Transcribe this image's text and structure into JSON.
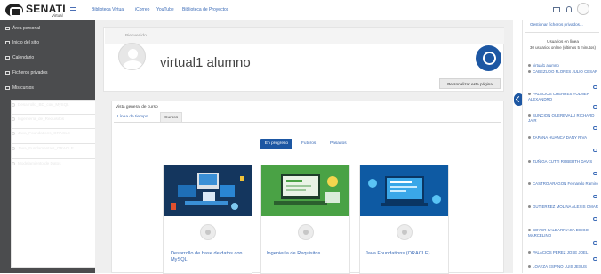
{
  "brand": {
    "name": "SENATI",
    "sub": "Virtual"
  },
  "top_links": [
    "Biblioteca Virtual",
    "iCorreo",
    "YouTube",
    "Biblioteca de Proyectos"
  ],
  "sidebar": {
    "items": [
      "Área personal",
      "Inicio del sitio",
      "Calendario",
      "Ficheros privados",
      "Mis cursos"
    ],
    "courses": [
      "Desarrollo_BD_con_MySQL",
      "Ingeniería_de_Requisitos",
      "Java_Foundations_ORACLE",
      "Java_Fundamentals_ORACLE",
      "Modelamiento de Datos"
    ]
  },
  "header": {
    "welcome": "Bienvenido",
    "username": "virtual1 alumno",
    "personalize_button": "Personalizar esta página"
  },
  "overview": {
    "title": "Vista general de curso",
    "tabs": [
      "Línea de tiempo",
      "Cursos"
    ],
    "filters": [
      "En progreso",
      "Futuros",
      "Pasados"
    ]
  },
  "courses": [
    {
      "title": "Desarrollo de base de datos con MySQL"
    },
    {
      "title": "Ingeniería de Requisitos"
    },
    {
      "title": "Java Foundations (ORACLE)"
    }
  ],
  "right_sidebar": {
    "manage_files": "Gestionar ficheros privados...",
    "online_header": "Usuarios en línea",
    "online_count": "30 usuarios online (últimos 5 minutos)",
    "users": [
      "virtual1 alumno",
      "CABEZUDO FLORES JULIO CESAR",
      "PALACIOS CHERRES YOLMER ALEXANDRO",
      "SUNCION QUEREVALU RICHARD JAIR",
      "ZAPANA HUANCA DANY RIVA",
      "ZUÑIGA CUTTI ROBERTH DAVIS",
      "CASTRO ARAGON Fernando Ramiro",
      "GUTIERREZ MOLINA ALEXIS OMAR",
      "BOYER SALDARRIAGA DIEGO MARCELINO",
      "PALACIOS PEREZ JOSE JOEL",
      "LOAYZA ESPINO LUIS JESUS"
    ]
  },
  "colors": {
    "sidebar": "#4b4c4e",
    "accent": "#1d57a3",
    "link": "#3b6bb7"
  }
}
